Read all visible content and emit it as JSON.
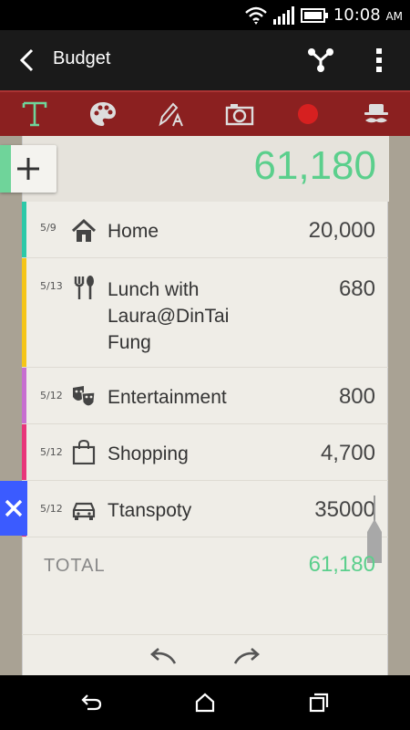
{
  "status": {
    "time": "10:08",
    "ampm": "AM"
  },
  "app_bar": {
    "title": "Budget"
  },
  "header": {
    "total": "61,180"
  },
  "entries": [
    {
      "date": "5/9",
      "label": "Home",
      "amount": "20,000",
      "color": "#2cc9a8",
      "icon": "home-icon"
    },
    {
      "date": "5/13",
      "label": "Lunch with Laura@DinTai Fung",
      "amount": "680",
      "color": "#f5c518",
      "icon": "fork-spoon-icon"
    },
    {
      "date": "5/12",
      "label": "Entertainment",
      "amount": "800",
      "color": "#c76fd0",
      "icon": "theater-masks-icon"
    },
    {
      "date": "5/12",
      "label": "Shopping",
      "amount": "4,700",
      "color": "#e8357a",
      "icon": "shopping-bag-icon"
    },
    {
      "date": "5/12",
      "label": "Ttanspoty",
      "amount": "35000",
      "color": "#e8357a",
      "icon": "car-icon"
    }
  ],
  "footer": {
    "total_label": "TOTAL",
    "total_value": "61,180"
  },
  "colors": {
    "accent_green": "#5bcf8c",
    "toolbar_red": "#8b2020",
    "delete_blue": "#3b5bff"
  }
}
